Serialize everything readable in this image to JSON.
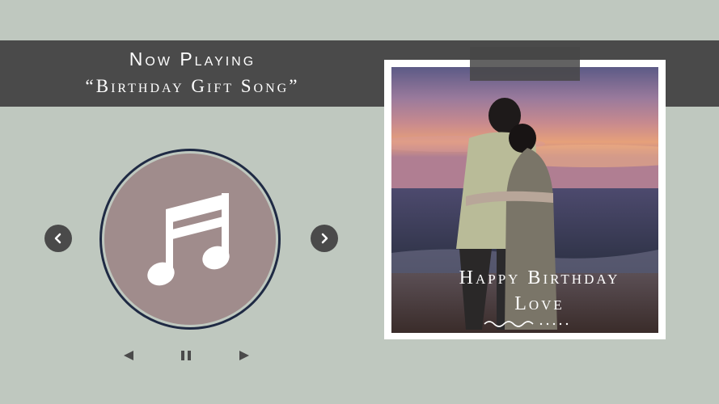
{
  "header": {
    "now_playing": "Now Playing",
    "song_title": "“Birthday Gift Song”"
  },
  "photo": {
    "caption_line1": "Happy Birthday",
    "caption_line2": "Love"
  },
  "icons": {
    "disc": "music-notes-icon",
    "nav_prev": "chevron-left-icon",
    "nav_next": "chevron-right-icon",
    "previous": "previous-triangle-icon",
    "pause": "pause-icon",
    "play": "play-triangle-icon"
  },
  "colors": {
    "background": "#bfc8bf",
    "band": "#4a4a4a",
    "disc": "#a08c8c",
    "ring": "#1f2a44"
  }
}
